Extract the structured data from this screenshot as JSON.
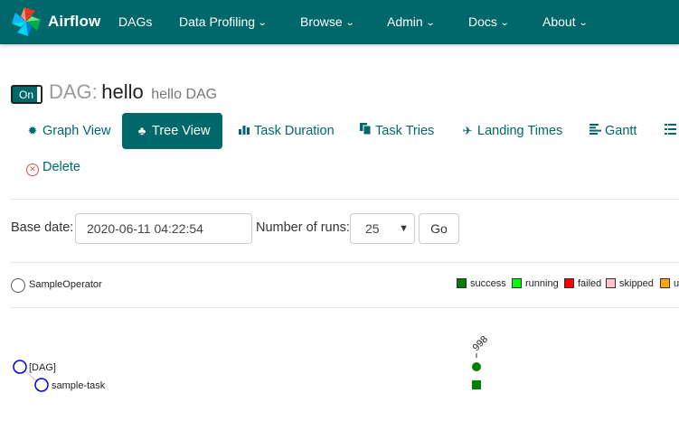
{
  "navbar": {
    "brand": "Airflow",
    "items": [
      {
        "label": "DAGs",
        "dropdown": false
      },
      {
        "label": "Data Profiling",
        "dropdown": true
      },
      {
        "label": "Browse",
        "dropdown": true
      },
      {
        "label": "Admin",
        "dropdown": true
      },
      {
        "label": "Docs",
        "dropdown": true
      },
      {
        "label": "About",
        "dropdown": true
      }
    ],
    "color": "#00676a"
  },
  "dag": {
    "toggle_label": "On",
    "title_prefix": "DAG:",
    "name": "hello",
    "description": "hello DAG"
  },
  "tabs": [
    {
      "label": "Graph View",
      "icon": "asterisk-icon",
      "active": false
    },
    {
      "label": "Tree View",
      "icon": "tree-icon",
      "active": true
    },
    {
      "label": "Task Duration",
      "icon": "bar-chart-icon",
      "active": false
    },
    {
      "label": "Task Tries",
      "icon": "duplicate-icon",
      "active": false
    },
    {
      "label": "Landing Times",
      "icon": "plane-icon",
      "active": false
    },
    {
      "label": "Gantt",
      "icon": "align-left-icon",
      "active": false
    }
  ],
  "delete_label": "Delete",
  "form": {
    "base_date_label": "Base date:",
    "base_date_value": "2020-06-11 04:22:54",
    "num_runs_label": "Number of runs:",
    "num_runs_value": "25",
    "go_label": "Go"
  },
  "operator_legend": {
    "label": "SampleOperator"
  },
  "state_legend": [
    {
      "label": "success",
      "color": "#008000"
    },
    {
      "label": "running",
      "color": "#00ff00"
    },
    {
      "label": "failed",
      "color": "#ff0000"
    },
    {
      "label": "skipped",
      "color": "#ffc0cb"
    },
    {
      "label": "u",
      "color": "#ffa500"
    }
  ],
  "tree": {
    "nodes": [
      {
        "label": "[DAG]"
      },
      {
        "label": "sample-task"
      }
    ],
    "run_label": "998"
  }
}
